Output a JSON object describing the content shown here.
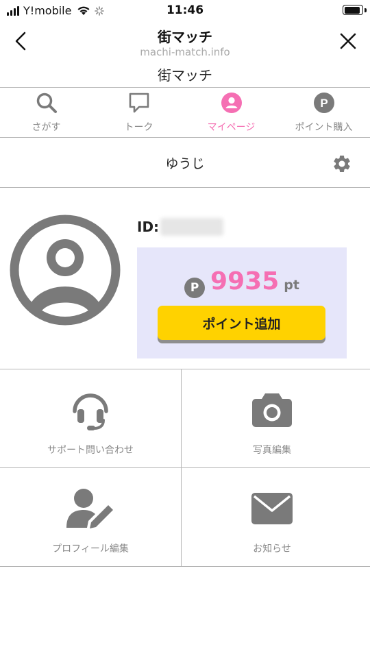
{
  "status_bar": {
    "carrier": "Y!mobile",
    "time": "11:46",
    "battery_level": 0.9
  },
  "browser": {
    "title": "街マッチ",
    "url": "machi-match.info",
    "back_icon": "chevron-left-icon",
    "close_icon": "close-icon"
  },
  "site": {
    "title": "街マッチ"
  },
  "tabs": [
    {
      "label": "さがす",
      "icon": "search-icon",
      "active": false
    },
    {
      "label": "トーク",
      "icon": "chat-icon",
      "active": false
    },
    {
      "label": "マイページ",
      "icon": "user-icon",
      "active": true
    },
    {
      "label": "ポイント購入",
      "icon": "point-icon",
      "active": false
    }
  ],
  "profile": {
    "username": "ゆうじ",
    "id_label": "ID:",
    "points_badge": "P",
    "points": "9935",
    "points_unit": "pt",
    "add_button": "ポイント追加"
  },
  "menu": [
    {
      "label": "サポート問い合わせ",
      "icon": "headset-icon"
    },
    {
      "label": "写真編集",
      "icon": "camera-icon"
    },
    {
      "label": "プロフィール編集",
      "icon": "user-edit-icon"
    },
    {
      "label": "お知らせ",
      "icon": "envelope-icon"
    }
  ],
  "colors": {
    "accent_pink": "#f56fb3",
    "icon_gray": "#7a7a7a",
    "points_bg": "#e6e6fa",
    "button_yellow": "#ffd200"
  }
}
